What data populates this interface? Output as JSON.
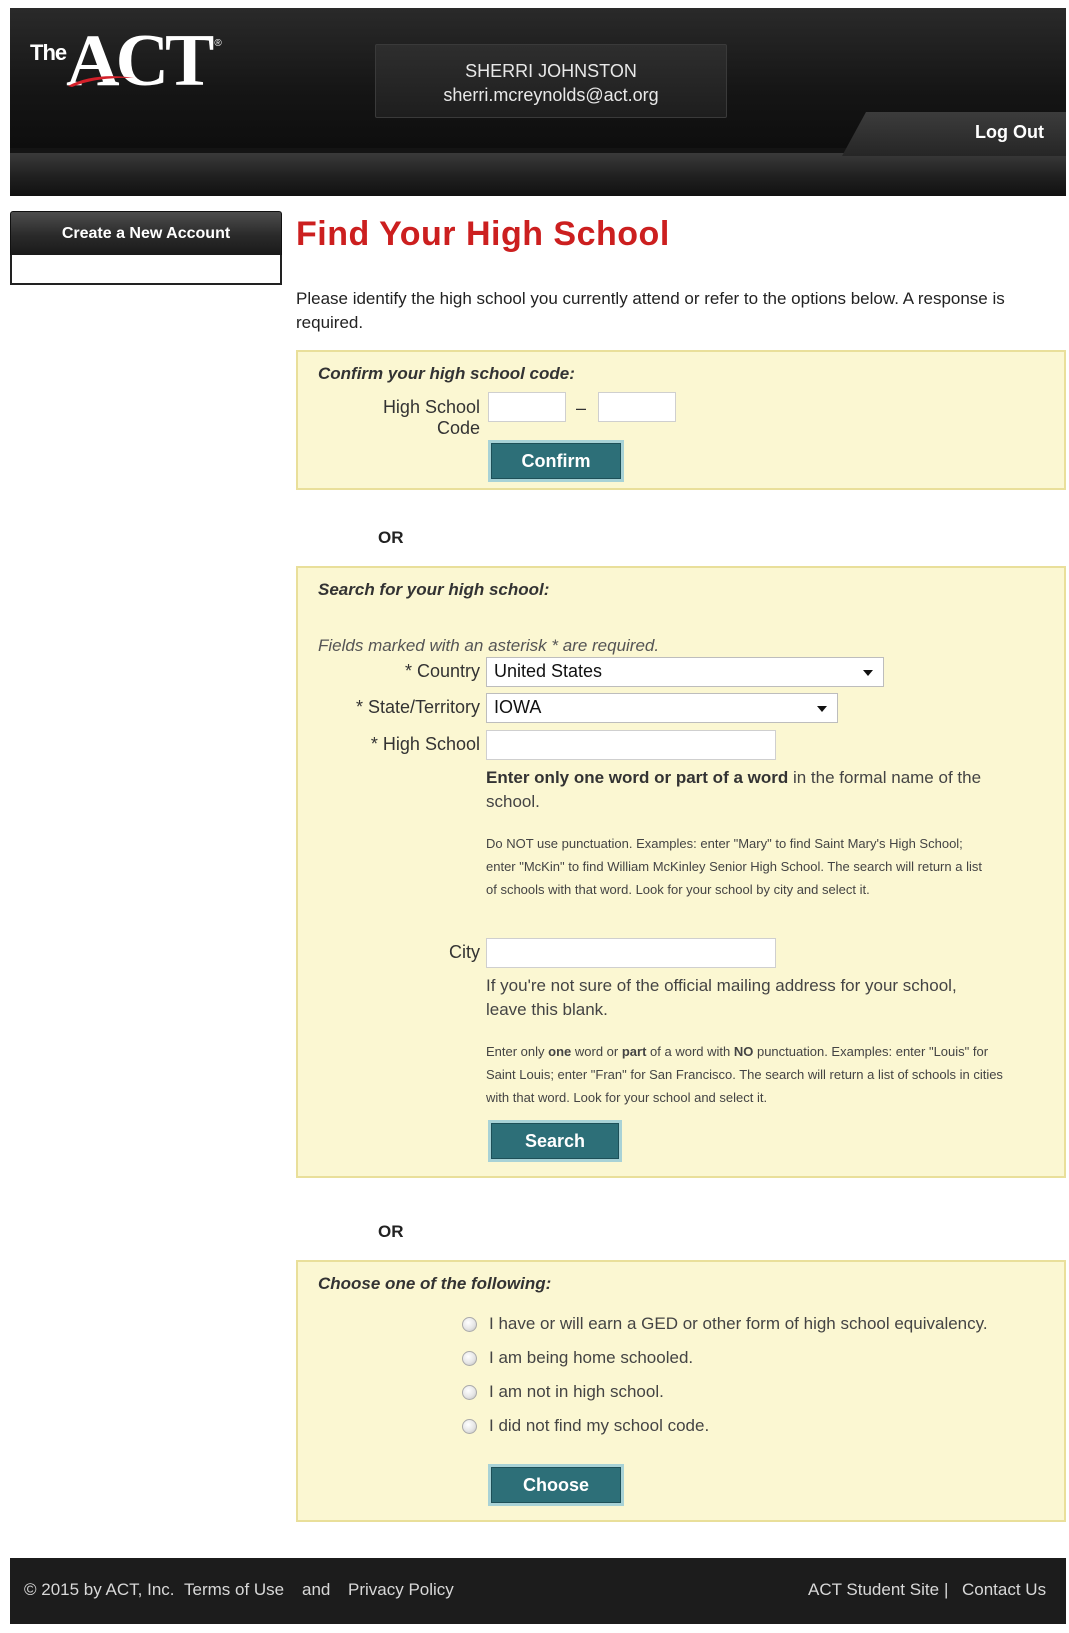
{
  "header": {
    "logo_the": "The",
    "logo_act": "ACT",
    "logo_reg": "®",
    "user_name": "SHERRI JOHNSTON",
    "user_email": "sherri.mcreynolds@act.org",
    "logout_label": "Log Out"
  },
  "sidebar": {
    "create_account_label": "Create a New Account"
  },
  "main": {
    "title": "Find Your High School",
    "intro": "Please identify the high school you currently attend or refer to the options below. A response is required.",
    "or_label": "OR"
  },
  "confirm_panel": {
    "title": "Confirm your high school code:",
    "code_label": "High School Code",
    "dash": "–",
    "code_part1": "",
    "code_part2": "",
    "button_label": "Confirm"
  },
  "search_panel": {
    "title": "Search for your high school:",
    "required_note": "Fields marked with an asterisk * are required.",
    "country_label": "* Country",
    "country_value": "United States",
    "state_label": "* State/Territory",
    "state_value": "IOWA",
    "school_label": "* High School",
    "school_value": "",
    "school_help_bold": "Enter only one word or part of a word",
    "school_help_rest": " in the formal name of the school.",
    "school_help_small": "Do NOT use punctuation. Examples: enter \"Mary\" to find Saint Mary's High School; enter \"McKin\" to find William McKinley Senior High School. The search will return a list of schools with that word. Look for your school by city and select it.",
    "city_label": "City",
    "city_value": "",
    "city_help": "If you're not sure of the official mailing address for your school, leave this blank.",
    "city_help_small": {
      "p1": "Enter only ",
      "b1": "one",
      "p2": " word or ",
      "b2": "part",
      "p3": " of a word with ",
      "b3": "NO",
      "p4": " punctuation. Examples: enter \"Louis\" for Saint Louis; enter \"Fran\" for San Francisco. The search will return a list of schools in cities with that word. Look for your school and select it."
    },
    "button_label": "Search"
  },
  "choose_panel": {
    "title": "Choose one of the following:",
    "options": [
      "I have or will earn a GED or other form of high school equivalency.",
      "I am being home schooled.",
      "I am not in high school.",
      "I did not find my school code."
    ],
    "button_label": "Choose"
  },
  "footer": {
    "copyright": "© 2015 by ACT, Inc.",
    "terms": "Terms of Use",
    "and": "and",
    "privacy": "Privacy Policy",
    "student_site": "ACT Student Site",
    "separator": "|",
    "contact": "Contact Us"
  },
  "colors": {
    "title_red": "#cc1f1f",
    "panel_bg": "#fbf7d2",
    "panel_border": "#e9df9a",
    "button_teal": "#2d6f78",
    "header_black": "#141414"
  }
}
